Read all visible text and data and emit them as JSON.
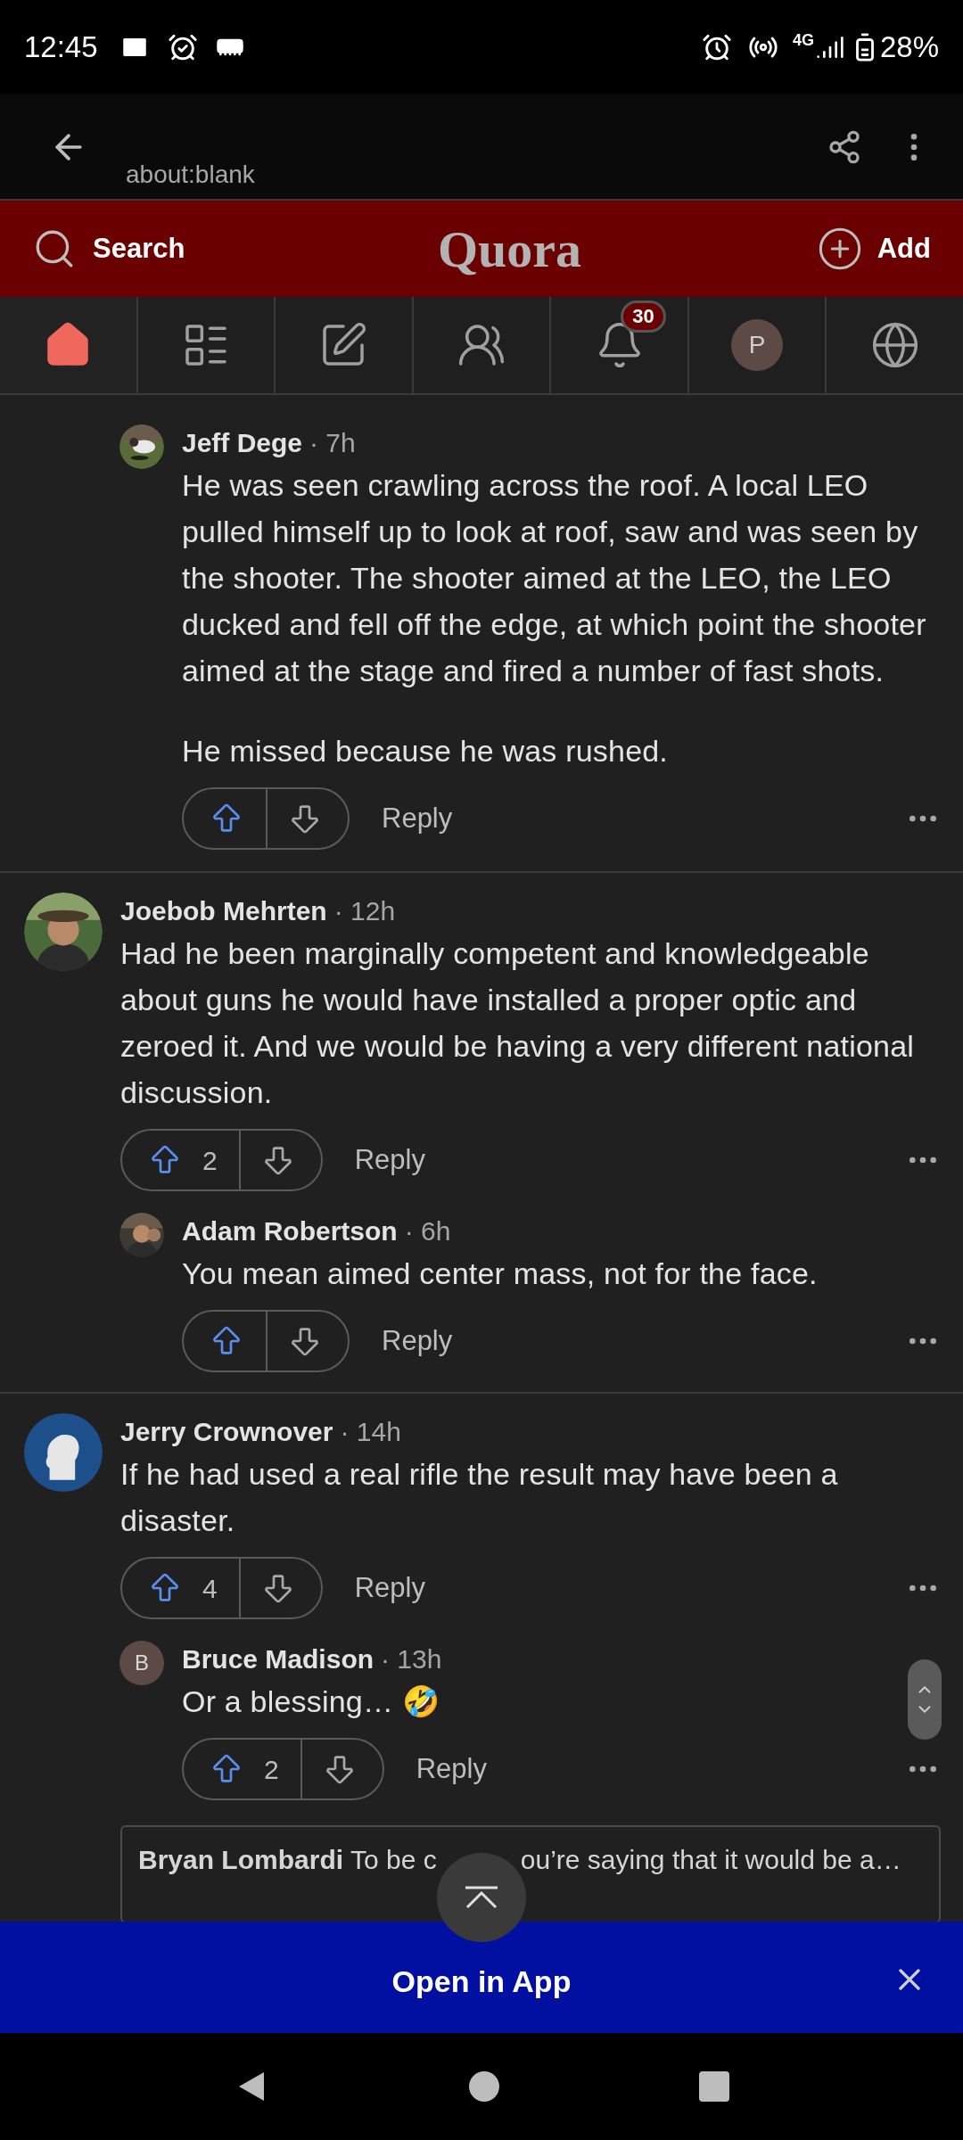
{
  "status_bar": {
    "time": "12:45",
    "network": "4G",
    "battery": "28%"
  },
  "browser_bar": {
    "url": "about:blank"
  },
  "header": {
    "search_label": "Search",
    "logo": "Quora",
    "add_label": "Add"
  },
  "nav_tabs": [
    {
      "kind": "home",
      "selected": true
    },
    {
      "kind": "list",
      "selected": false
    },
    {
      "kind": "write",
      "selected": false
    },
    {
      "kind": "spaces",
      "selected": false
    },
    {
      "kind": "notifications",
      "selected": false,
      "badge": "30"
    },
    {
      "kind": "profile",
      "selected": false,
      "initial": "P"
    },
    {
      "kind": "globe",
      "selected": false
    }
  ],
  "continued_replies": [
    {
      "author": "Jeff Dege",
      "time": "· 7h",
      "avatar": {
        "kind": "picture"
      },
      "paragraphs": [
        "He was seen crawling across the roof. A local LEO pulled himself up to look at roof, saw and was seen by the shooter. The shooter aimed at the LEO, the LEO ducked and fell off the edge, at which point the shooter aimed at the stage and fired a number of fast shots.",
        "He missed because he was rushed."
      ],
      "reply_label": "Reply"
    }
  ],
  "comments": [
    {
      "author": "Joebob Mehrten",
      "time": "· 12h",
      "avatar": {
        "kind": "picture"
      },
      "paragraphs": [
        "Had he been marginally competent and knowledgeable about guns he would have installed a proper optic and zeroed it. And we would be having a very different national discussion."
      ],
      "upvotes": "2",
      "reply_label": "Reply",
      "replies": [
        {
          "author": "Adam Robertson",
          "time": "· 6h",
          "avatar": {
            "kind": "picture"
          },
          "paragraphs": [
            "You mean aimed center mass, not for the face."
          ],
          "reply_label": "Reply"
        }
      ]
    },
    {
      "author": "Jerry Crownover",
      "time": "· 14h",
      "avatar": {
        "kind": "silhouette"
      },
      "paragraphs": [
        "If he had used a real rifle the result may have been a disaster."
      ],
      "upvotes": "4",
      "reply_label": "Reply",
      "replies": [
        {
          "author": "Bruce Madison",
          "time": "· 13h",
          "avatar": {
            "kind": "initial",
            "initial": "B"
          },
          "paragraphs": [
            "Or a blessing… 🤣"
          ],
          "upvotes": "2",
          "reply_label": "Reply"
        }
      ],
      "collapsed_reply": {
        "author": "Bryan Lombardi",
        "text_parts": [
          "To be c",
          "ou’re saying that it would be a…"
        ]
      }
    }
  ],
  "app_banner": {
    "label": "Open in App"
  }
}
